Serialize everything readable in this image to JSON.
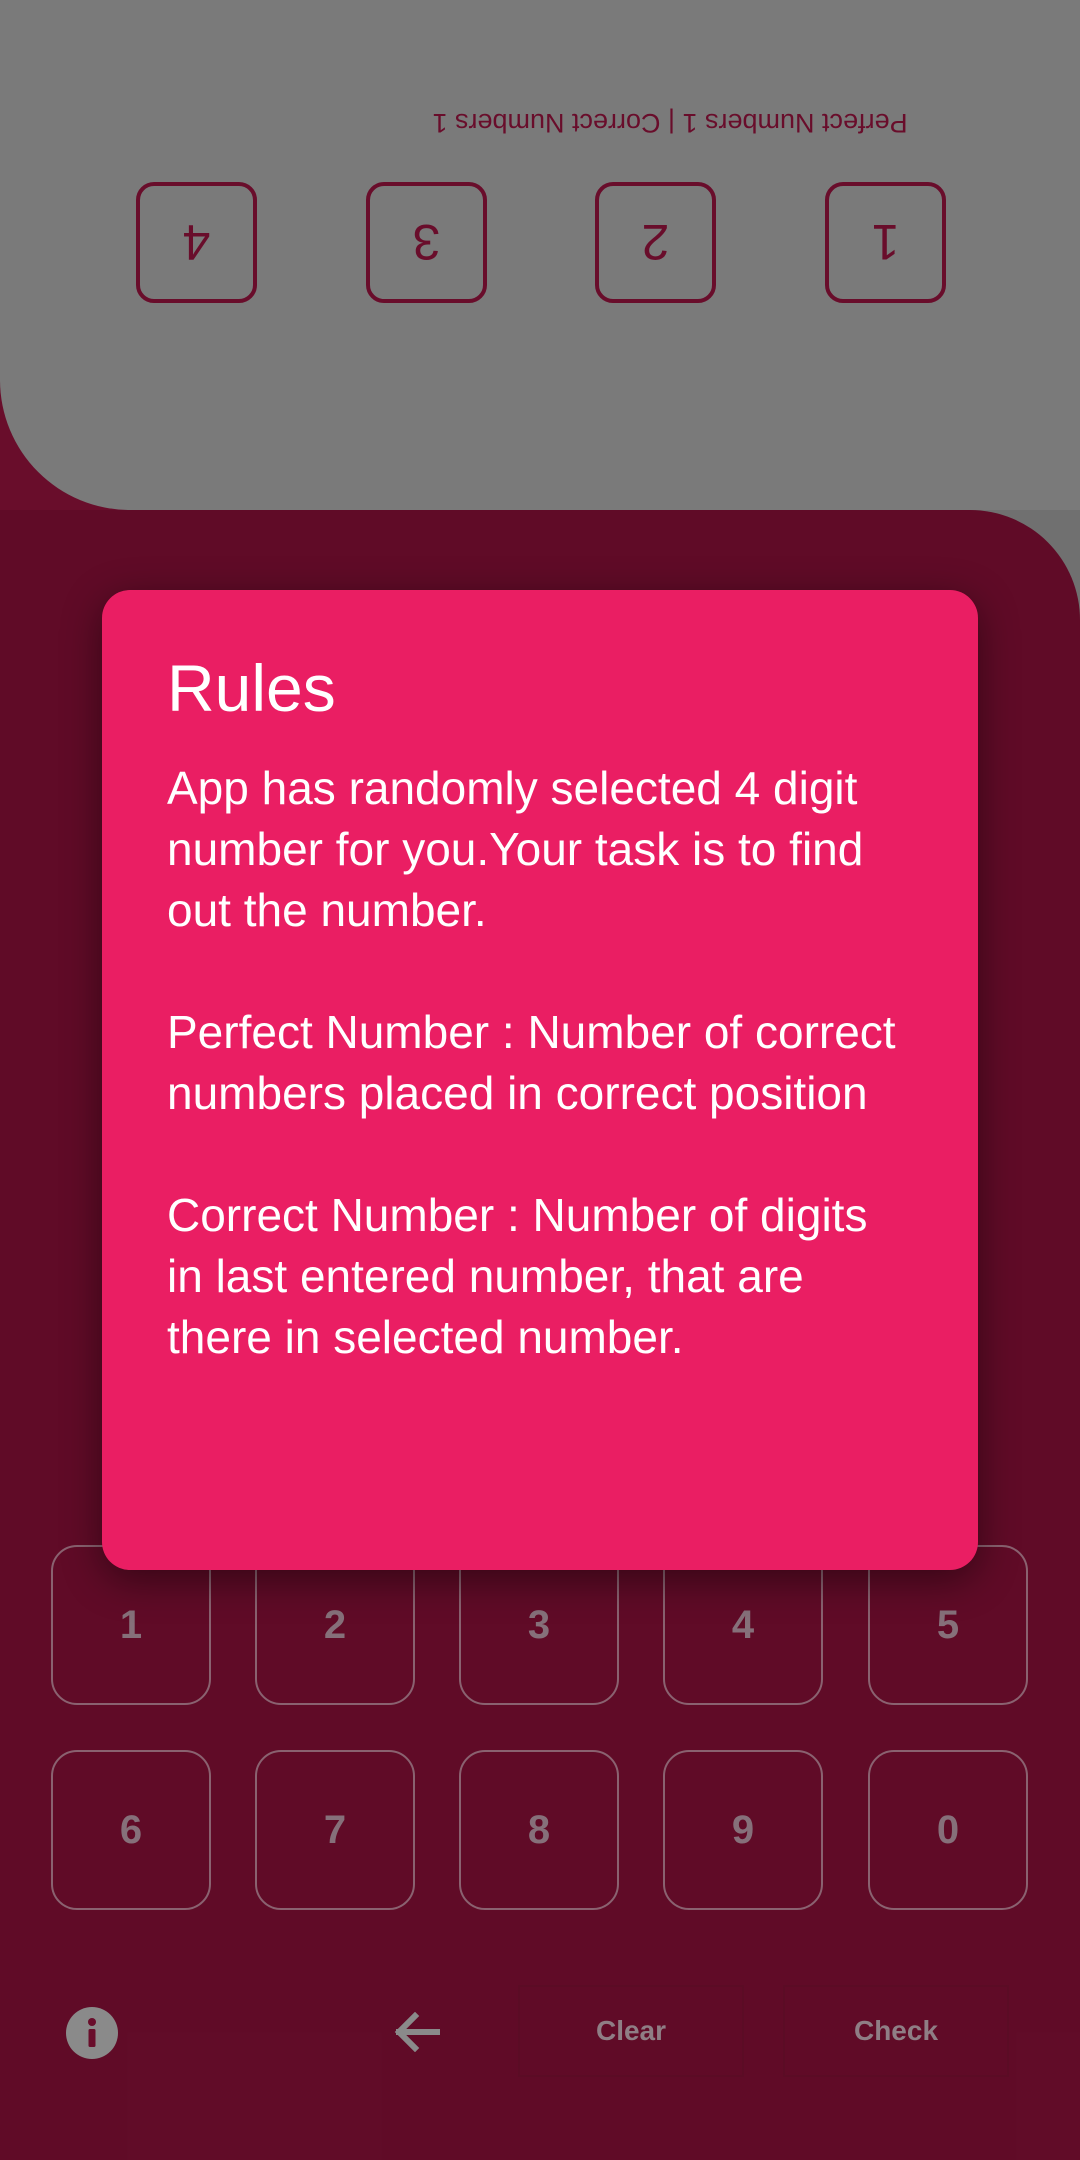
{
  "opponent": {
    "score_text": "Perfect Numbers 1 | Correct Numbers 1",
    "slots": [
      "1",
      "2",
      "3",
      "4"
    ]
  },
  "keypad": {
    "row1": [
      "1",
      "2",
      "3",
      "4",
      "5"
    ],
    "row2": [
      "6",
      "7",
      "8",
      "9",
      "0"
    ]
  },
  "actions": {
    "info_icon": "info-icon",
    "back_icon": "arrow-left-icon",
    "clear_label": "Clear",
    "check_label": "Check"
  },
  "dialog": {
    "title": "Rules",
    "paragraphs": [
      "App has randomly selected 4 digit number for you.Your task is to find out the number.",
      "Perfect Number : Number of correct numbers placed in correct position",
      "Correct Number : Number of digits in last entered number, that are there in selected number."
    ]
  },
  "colors": {
    "background": "#690d2b",
    "top_panel": "#7a7a7a",
    "dialog": "#ea1e63",
    "text_on_dialog": "#ffffff"
  }
}
